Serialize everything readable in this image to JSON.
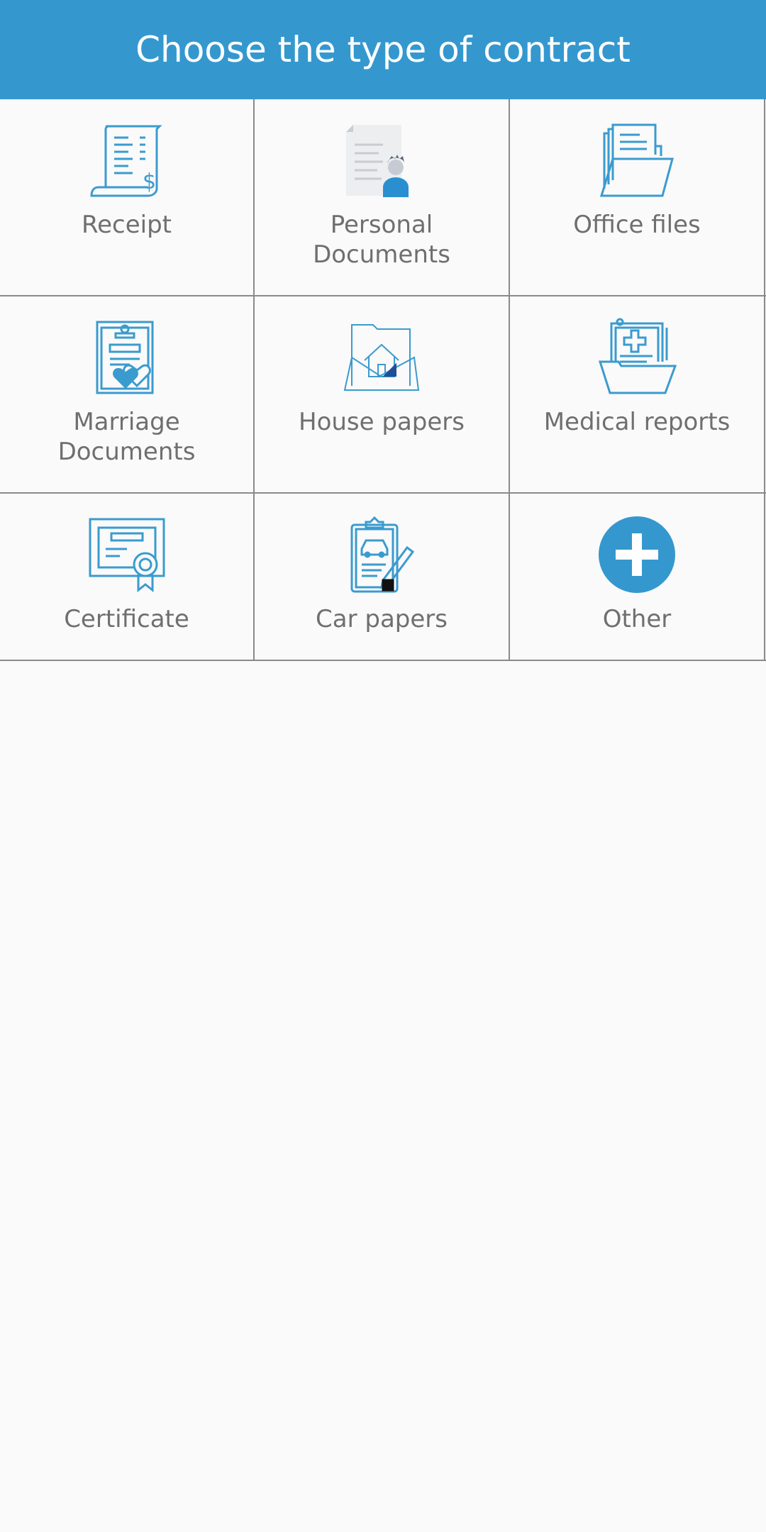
{
  "header": {
    "title": "Choose the type of contract"
  },
  "accent_color": "#3498cf",
  "items": [
    {
      "label": "Receipt",
      "icon": "receipt-icon"
    },
    {
      "label": "Personal\nDocuments",
      "icon": "personal-documents-icon"
    },
    {
      "label": "Office files",
      "icon": "office-files-icon"
    },
    {
      "label": "Marriage\nDocuments",
      "icon": "marriage-documents-icon"
    },
    {
      "label": "House papers",
      "icon": "house-papers-icon"
    },
    {
      "label": "Medical reports",
      "icon": "medical-reports-icon"
    },
    {
      "label": "Certificate",
      "icon": "certificate-icon"
    },
    {
      "label": "Car papers",
      "icon": "car-papers-icon"
    },
    {
      "label": "Other",
      "icon": "add-icon"
    }
  ]
}
